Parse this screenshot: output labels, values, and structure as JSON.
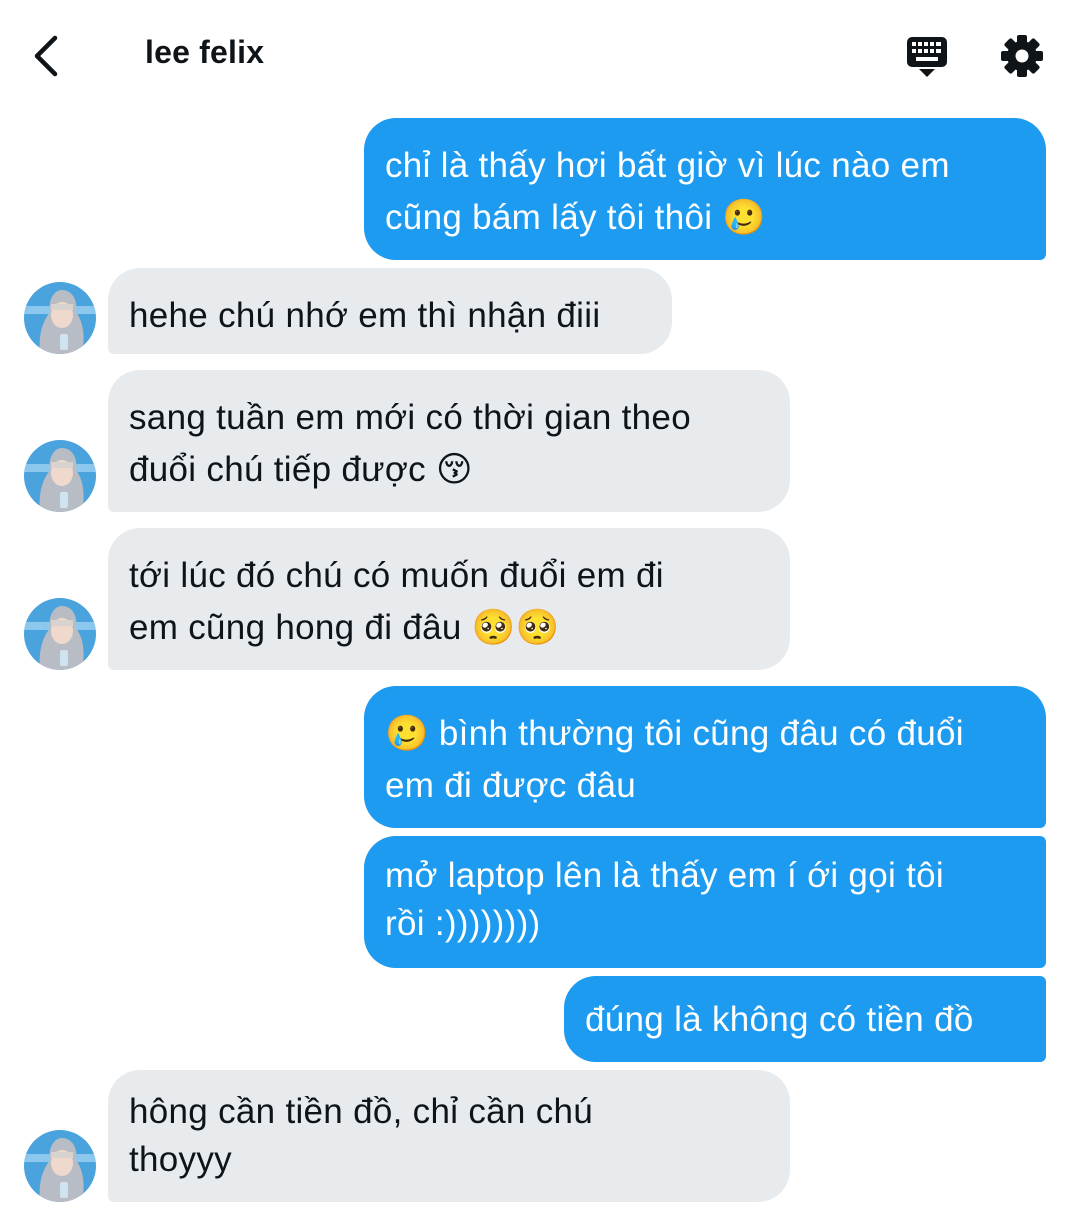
{
  "header": {
    "title": "lee felix"
  },
  "icons": {
    "back": "chevron-left-icon",
    "keyboard": "keyboard-icon",
    "settings": "gear-icon"
  },
  "colors": {
    "outgoing_bubble": "#1d9bf0",
    "incoming_bubble": "#e8ebee",
    "text_primary": "#0f1419"
  },
  "messages": [
    {
      "direction": "out",
      "text": "chỉ là thấy hơi bất giờ vì lúc nào em\ncũng bám lấy tôi thôi 🥲"
    },
    {
      "direction": "in",
      "text": "hehe chú nhớ em thì nhận điii"
    },
    {
      "direction": "in",
      "text": "sang tuần em mới có thời gian theo\nđuổi chú tiếp được 😚"
    },
    {
      "direction": "in",
      "text": "tới lúc đó chú có muốn đuổi em đi\nem cũng hong đi đâu 🥺🥺"
    },
    {
      "direction": "out",
      "text": "🥲 bình thường tôi cũng đâu có đuổi\nem đi được đâu"
    },
    {
      "direction": "out",
      "text": "mở laptop lên là thấy em í ới gọi tôi\nrồi :))))))))"
    },
    {
      "direction": "out",
      "text": "đúng là không có tiền đồ"
    },
    {
      "direction": "in",
      "text": "hông cần tiền đồ, chỉ cần chú\nthoyyy"
    }
  ]
}
